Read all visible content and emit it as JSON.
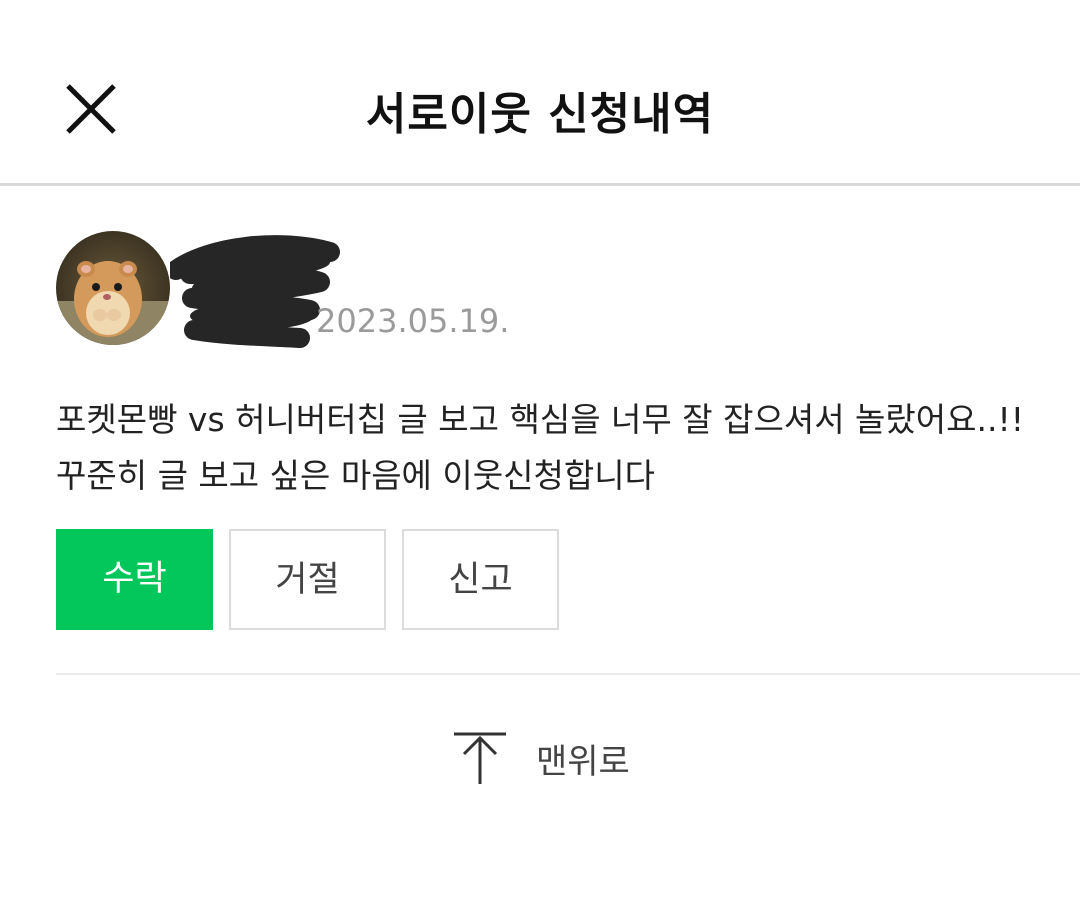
{
  "header": {
    "title": "서로이웃 신청내역",
    "close_icon": "close-icon"
  },
  "request": {
    "avatar_icon": "hamster-avatar",
    "date": "2023.05.19.",
    "message": "포켓몬빵 vs 허니버터칩 글 보고 핵심을 너무 잘 잡으셔서 놀랐어요..!! 꾸준히 글 보고 싶은 마음에 이웃신청합니다",
    "buttons": {
      "accept": "수락",
      "reject": "거절",
      "report": "신고"
    }
  },
  "footer": {
    "to_top_label": "맨위로",
    "to_top_icon": "arrow-up-icon"
  },
  "colors": {
    "accent": "#03c75a",
    "date": "#9a9a9a",
    "border": "#dcdcdc"
  }
}
